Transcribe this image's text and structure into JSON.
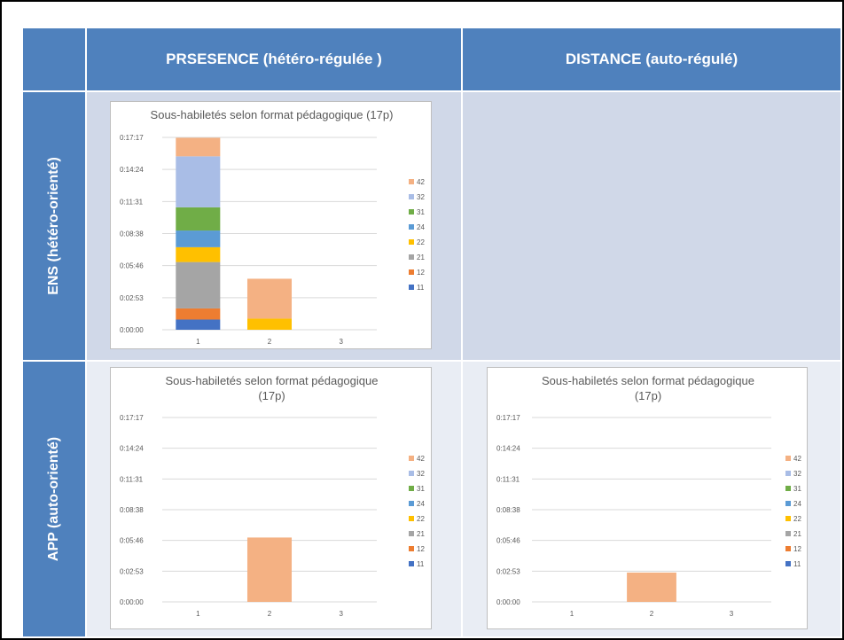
{
  "table": {
    "col_headers": [
      "PRSESENCE (hétéro-régulée )",
      "DISTANCE (auto-régulé)"
    ],
    "row_headers": [
      "ENS (hétéro-orienté)",
      "APP (auto-orienté)"
    ]
  },
  "colors": {
    "11": "#4472c4",
    "12": "#ed7d31",
    "21": "#a5a5a5",
    "22": "#ffc000",
    "24": "#5b9bd5",
    "31": "#70ad47",
    "32": "#a9bde6",
    "42": "#f4b183",
    "header_bg": "#4f81bd",
    "cell_dark": "#d0d8e8",
    "cell_light": "#e9edf4"
  },
  "chart_data": [
    {
      "type": "bar",
      "stacked": true,
      "title": "Sous-habiletés selon format pédagogique  (17p)",
      "categories": [
        "1",
        "2",
        "3"
      ],
      "ytick_labels": [
        "0:00:00",
        "0:02:53",
        "0:05:46",
        "0:08:38",
        "0:11:31",
        "0:14:24",
        "0:17:17"
      ],
      "ylim_seconds": [
        0,
        1037
      ],
      "legend": [
        "42",
        "32",
        "31",
        "24",
        "22",
        "21",
        "12",
        "11"
      ],
      "legend_position": "right",
      "series": [
        {
          "name": "11",
          "values": [
            55,
            0,
            0
          ]
        },
        {
          "name": "12",
          "values": [
            60,
            0,
            0
          ]
        },
        {
          "name": "21",
          "values": [
            250,
            0,
            0
          ]
        },
        {
          "name": "22",
          "values": [
            80,
            60,
            0
          ]
        },
        {
          "name": "24",
          "values": [
            90,
            0,
            0
          ]
        },
        {
          "name": "31",
          "values": [
            125,
            0,
            0
          ]
        },
        {
          "name": "32",
          "values": [
            275,
            0,
            0
          ]
        },
        {
          "name": "42",
          "values": [
            100,
            215,
            0
          ]
        }
      ]
    },
    {
      "type": "bar",
      "stacked": true,
      "title": "Sous-habiletés selon format pédagogique (17p)",
      "title_lines": [
        "Sous-habiletés selon format pédagogique",
        "(17p)"
      ],
      "categories": [
        "1",
        "2",
        "3"
      ],
      "ytick_labels": [
        "0:00:00",
        "0:02:53",
        "0:05:46",
        "0:08:38",
        "0:11:31",
        "0:14:24",
        "0:17:17"
      ],
      "ylim_seconds": [
        0,
        1037
      ],
      "legend": [
        "42",
        "32",
        "31",
        "24",
        "22",
        "21",
        "12",
        "11"
      ],
      "legend_position": "right",
      "series": [
        {
          "name": "11",
          "values": [
            0,
            0,
            0
          ]
        },
        {
          "name": "12",
          "values": [
            0,
            0,
            0
          ]
        },
        {
          "name": "21",
          "values": [
            0,
            0,
            0
          ]
        },
        {
          "name": "22",
          "values": [
            0,
            0,
            0
          ]
        },
        {
          "name": "24",
          "values": [
            0,
            0,
            0
          ]
        },
        {
          "name": "31",
          "values": [
            0,
            0,
            0
          ]
        },
        {
          "name": "32",
          "values": [
            0,
            0,
            0
          ]
        },
        {
          "name": "42",
          "values": [
            0,
            362,
            0
          ]
        }
      ]
    },
    {
      "type": "bar",
      "stacked": true,
      "title": "Sous-habiletés selon format pédagogique (17p)",
      "title_lines": [
        "Sous-habiletés selon format pédagogique",
        "(17p)"
      ],
      "categories": [
        "1",
        "2",
        "3"
      ],
      "ytick_labels": [
        "0:00:00",
        "0:02:53",
        "0:05:46",
        "0:08:38",
        "0:11:31",
        "0:14:24",
        "0:17:17"
      ],
      "ylim_seconds": [
        0,
        1037
      ],
      "legend": [
        "42",
        "32",
        "31",
        "24",
        "22",
        "21",
        "12",
        "11"
      ],
      "legend_position": "right",
      "series": [
        {
          "name": "11",
          "values": [
            0,
            0,
            0
          ]
        },
        {
          "name": "12",
          "values": [
            0,
            0,
            0
          ]
        },
        {
          "name": "21",
          "values": [
            0,
            0,
            0
          ]
        },
        {
          "name": "22",
          "values": [
            0,
            0,
            0
          ]
        },
        {
          "name": "24",
          "values": [
            0,
            0,
            0
          ]
        },
        {
          "name": "31",
          "values": [
            0,
            0,
            0
          ]
        },
        {
          "name": "32",
          "values": [
            0,
            0,
            0
          ]
        },
        {
          "name": "42",
          "values": [
            0,
            165,
            0
          ]
        }
      ]
    }
  ]
}
